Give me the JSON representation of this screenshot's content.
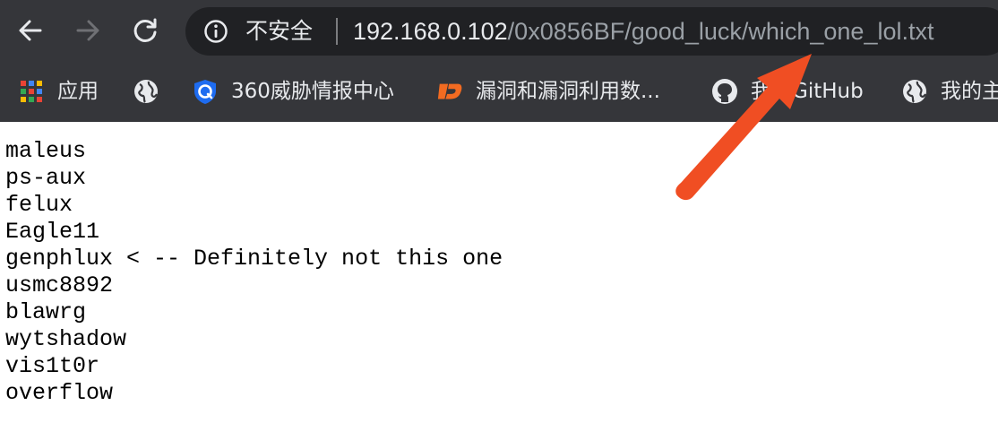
{
  "browser": {
    "nav": {
      "back_icon": "arrow-left-icon",
      "forward_icon": "arrow-right-icon",
      "reload_icon": "reload-icon"
    },
    "omnibox": {
      "security_icon": "info-circle-icon",
      "security_label": "不安全",
      "url_host": "192.168.0.102",
      "url_path": "/0x0856BF/good_luck/which_one_lol.txt"
    },
    "bookmarks": [
      {
        "icon": "apps-grid-icon",
        "label": "应用"
      },
      {
        "icon": "globe-icon",
        "label": ""
      },
      {
        "icon": "360-shield-icon",
        "label": "360威胁情报中心"
      },
      {
        "icon": "vuln-site-logo-icon",
        "label": "漏洞和漏洞利用数..."
      },
      {
        "icon": "github-icon",
        "label": "我的GitHub"
      },
      {
        "icon": "globe-icon",
        "label": "我的主"
      }
    ]
  },
  "page": {
    "lines": [
      "maleus",
      "ps-aux",
      "felux",
      "Eagle11",
      "genphlux < -- Definitely not this one",
      "usmc8892",
      "blawrg",
      "wytshadow",
      "vis1t0r",
      "overflow"
    ]
  },
  "annotation": {
    "color": "#f04e23",
    "icon": "red-arrow-annotation"
  },
  "colors": {
    "chrome_bg": "#35363a",
    "omnibox_bg": "#202124",
    "text_light": "#e8eaed",
    "text_dim": "#9aa0a6"
  }
}
